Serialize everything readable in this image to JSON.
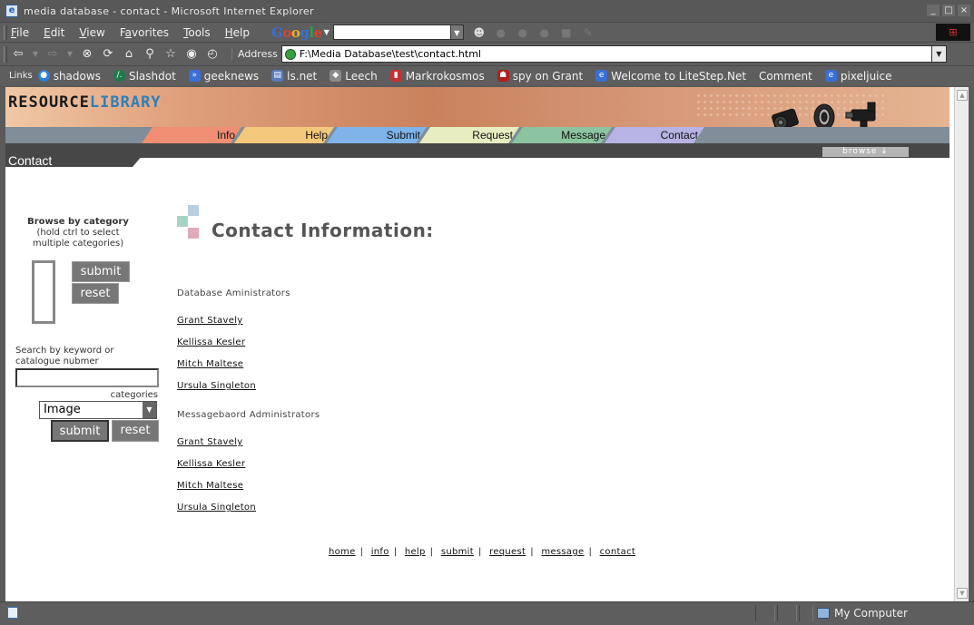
{
  "window": {
    "title": "media database - contact - Microsoft Internet Explorer",
    "controls": [
      "_",
      "□",
      "×"
    ]
  },
  "menu": {
    "items": [
      {
        "key": "F",
        "rest": "ile"
      },
      {
        "key": "E",
        "rest": "dit"
      },
      {
        "key": "V",
        "rest": "iew"
      },
      {
        "key": "F",
        "rest": "avorites",
        "prefix": ""
      },
      {
        "key": "T",
        "rest": "ools"
      },
      {
        "key": "H",
        "rest": "elp"
      }
    ],
    "google_logo": [
      "G",
      "o",
      "o",
      "g",
      "l",
      "e"
    ]
  },
  "address": {
    "label": "Address",
    "url": "F:\\Media Database\\test\\contact.html"
  },
  "links": {
    "label": "Links",
    "items": [
      {
        "label": "shadows",
        "icon": "globe-icon",
        "color": "#2f7fd8"
      },
      {
        "label": "Slashdot",
        "icon": "slashdot-icon",
        "color": "#1f7a4a"
      },
      {
        "label": "geeknews",
        "icon": "arrow-icon",
        "color": "#3a6fd8"
      },
      {
        "label": "ls.net",
        "icon": "page-icon",
        "color": "#5a7ab8"
      },
      {
        "label": "Leech",
        "icon": "cube-icon",
        "color": "#8a8a8a"
      },
      {
        "label": "Markrokosmos",
        "icon": "bottle-icon",
        "color": "#c83030"
      },
      {
        "label": "spy on Grant",
        "icon": "ghost-icon",
        "color": "#b02020"
      },
      {
        "label": "Welcome to LiteStep.Net",
        "icon": "ie-page-icon",
        "color": "#3a6fd8"
      },
      {
        "label": "Comment",
        "icon": "",
        "color": ""
      },
      {
        "label": "pixeljuice",
        "icon": "ie-page-icon",
        "color": "#3a6fd8"
      }
    ]
  },
  "site": {
    "brand_1": "RESOURCE",
    "brand_2": "LIBRARY",
    "tabs": [
      {
        "label": "Info",
        "color": "#ef8e73"
      },
      {
        "label": "Help",
        "color": "#f4c87c"
      },
      {
        "label": "Submit",
        "color": "#7fb4ea"
      },
      {
        "label": "Request",
        "color": "#e7edc0"
      },
      {
        "label": "Message",
        "color": "#8cc3a0"
      },
      {
        "label": "Contact",
        "color": "#b7b3e4"
      }
    ],
    "browse_label": "browse ↓",
    "section": "Contact"
  },
  "sidebar": {
    "browse_title": "Browse by category",
    "browse_hint_1": "(hold ctrl to select",
    "browse_hint_2": "multiple categories)",
    "submit_label": "submit",
    "reset_label": "reset",
    "search_label_1": "Search by keyword or",
    "search_label_2": "catalogue nubmer",
    "search_value": "",
    "categories_label": "categories",
    "category_selected": "Image"
  },
  "main": {
    "heading": "Contact Information:",
    "groups": [
      {
        "label": "Database Aministrators",
        "people": [
          "Grant Stavely",
          "Kellissa Kesler",
          "Mitch Maltese",
          "Ursula Singleton"
        ]
      },
      {
        "label": "Messagebaord Administrators",
        "people": [
          "Grant Stavely",
          "Kellissa Kesler",
          "Mitch Maltese",
          "Ursula Singleton"
        ]
      }
    ]
  },
  "footer_nav": [
    "home",
    "info",
    "help",
    "submit",
    "request",
    "message",
    "contact"
  ],
  "status": {
    "zone": "My Computer"
  }
}
